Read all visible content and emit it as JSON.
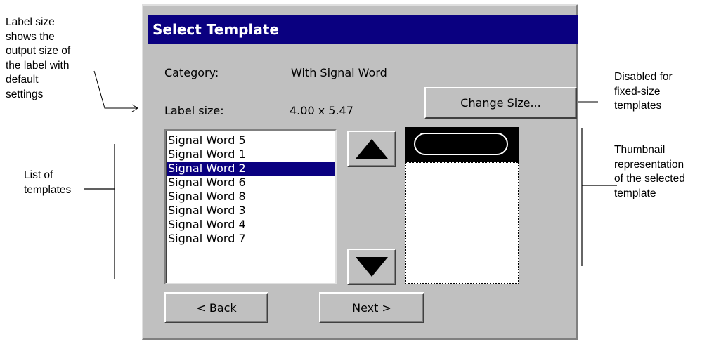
{
  "annotations": {
    "label_size_note": [
      "Label size",
      "shows the",
      "output size of",
      "the label with",
      "default",
      "settings"
    ],
    "templates_note": [
      "List of",
      "templates"
    ],
    "disabled_note": [
      "Disabled for",
      "fixed-size",
      "templates"
    ],
    "thumbnail_note": [
      "Thumbnail",
      "representation",
      "of the selected",
      "template"
    ]
  },
  "dialog": {
    "title": "Select Template",
    "category_label": "Category:",
    "category_value": "With Signal Word",
    "label_size_label": "Label size:",
    "label_size_value": "4.00 x 5.47",
    "change_size_button": "Change Size...",
    "templates": [
      "Signal Word 5",
      "Signal Word 1",
      "Signal Word 2",
      "Signal Word 6",
      "Signal Word 8",
      "Signal Word 3",
      "Signal Word 4",
      "Signal Word 7"
    ],
    "selected_template": "Signal Word 2",
    "back_button": "< Back",
    "next_button": "Next >"
  },
  "colors": {
    "titlebar": "#0a0080",
    "dialog_face": "#c0c0c0",
    "selection": "#0a0080"
  },
  "icons": {
    "scroll_up": "triangle-up-icon",
    "scroll_down": "triangle-down-icon"
  }
}
